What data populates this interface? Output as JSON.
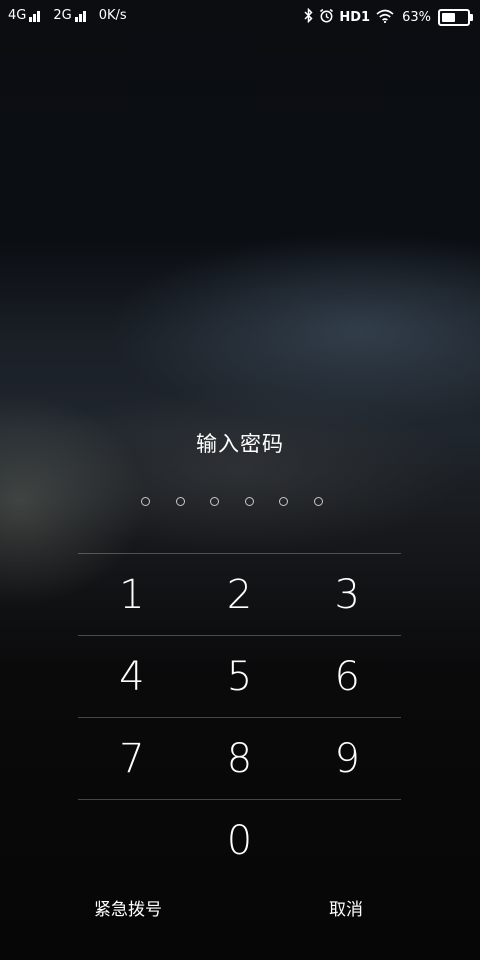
{
  "status_bar": {
    "sim1": "4G",
    "sim2": "2G",
    "speed": "0K/s",
    "hd": "HD1",
    "battery": "63%",
    "battery_level": 0.63
  },
  "lock": {
    "title": "输入密码",
    "pin_length": 6
  },
  "keypad": {
    "k1": "1",
    "k2": "2",
    "k3": "3",
    "k4": "4",
    "k5": "5",
    "k6": "6",
    "k7": "7",
    "k8": "8",
    "k9": "9",
    "k0": "0"
  },
  "actions": {
    "emergency": "紧急拨号",
    "cancel": "取消"
  },
  "icons": {
    "bluetooth": "bluetooth-icon",
    "alarm": "alarm-icon",
    "wifi": "wifi-icon",
    "battery": "battery-icon"
  }
}
